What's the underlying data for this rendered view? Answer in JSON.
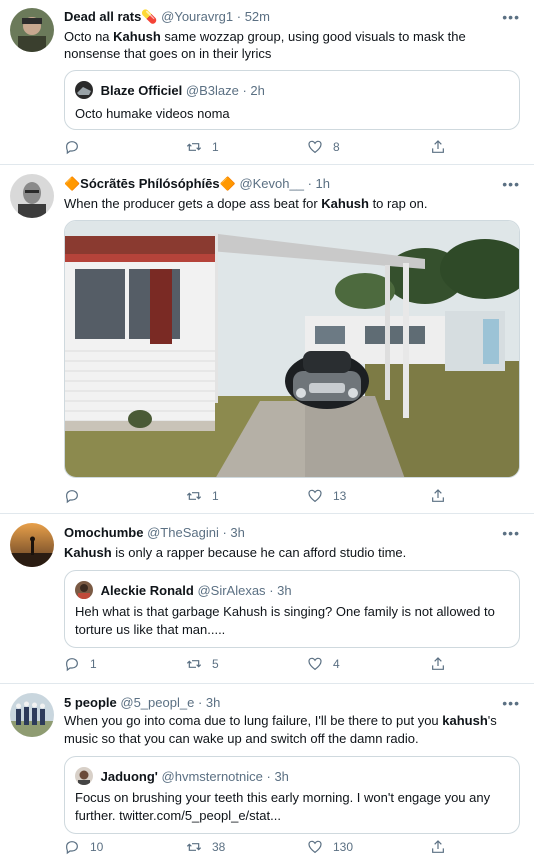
{
  "tweets": [
    {
      "name": "Dead all rats",
      "emoji": "💊",
      "handle": "@Youravrg1",
      "time": "· 52m",
      "text_pre": "Octo na ",
      "text_bold": "Kahush",
      "text_post": " same wozzap group, using good visuals to mask the nonsense that goes on in their lyrics",
      "quote": {
        "name": "Blaze Officiel",
        "handle": "@B3laze",
        "time": "· 2h",
        "text": "Octo humake videos noma"
      },
      "replies": "",
      "retweets": "1",
      "likes": "8"
    },
    {
      "name": "🔶Sócrãtēs Phílósóphíēs🔶",
      "handle": "@Kevoh__",
      "time": "· 1h",
      "text_pre": "When the producer gets a dope ass beat for ",
      "text_bold": "Kahush",
      "text_post": " to rap on.",
      "replies": "",
      "retweets": "1",
      "likes": "13"
    },
    {
      "name": "Omochumbe",
      "handle": "@TheSagini",
      "time": "· 3h",
      "text_pre": "",
      "text_bold": "Kahush",
      "text_post": " is only a rapper because he can afford studio time.",
      "quote": {
        "name": "Aleckie Ronald",
        "handle": "@SirAlexas",
        "time": "· 3h",
        "text": "Heh what is that garbage Kahush is singing? One family is not allowed to torture us like that man....."
      },
      "replies": "1",
      "retweets": "5",
      "likes": "4"
    },
    {
      "name": "5 people",
      "handle": "@5_peopl_e",
      "time": "· 3h",
      "text_pre": "When you go into coma due to lung failure, I'll be there to put you ",
      "text_bold": "kahush",
      "text_post": "'s music so that you can wake up and switch off the damn radio.",
      "quote": {
        "name": "Jaduong'",
        "handle": "@hvmsternotnice",
        "time": "· 3h",
        "text": "Focus on brushing your teeth this early morning. I won't engage you any further. twitter.com/5_peopl_e/stat..."
      },
      "replies": "10",
      "retweets": "38",
      "likes": "130"
    }
  ],
  "more_label": "•••",
  "colors": {
    "text": "#0f1419",
    "secondary": "#5b7083",
    "border": "#e1e8ed",
    "quote_border": "#cfd9de"
  },
  "icons": [
    "reply-icon",
    "retweet-icon",
    "like-icon",
    "share-icon",
    "more-icon"
  ]
}
